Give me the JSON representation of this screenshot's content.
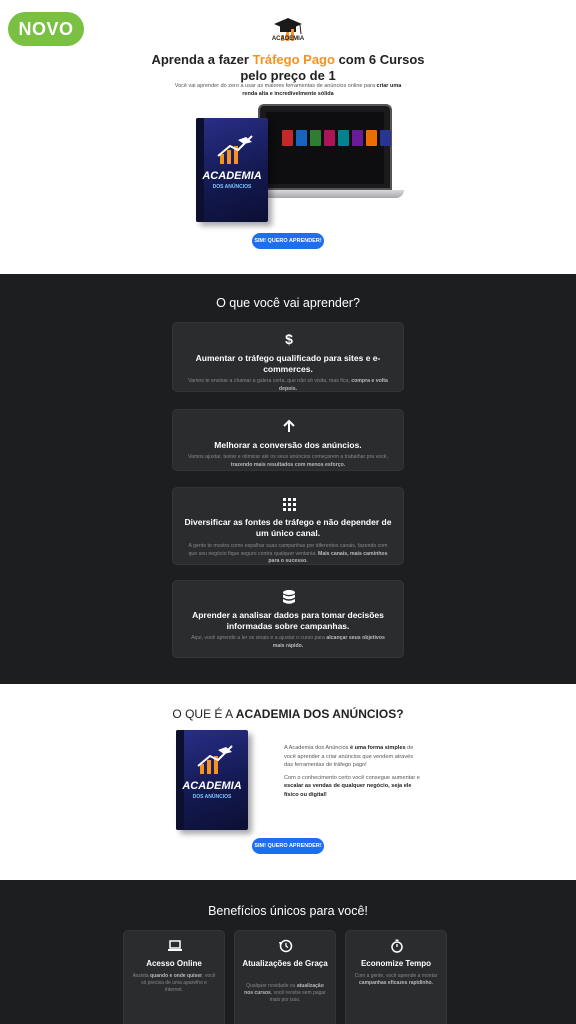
{
  "badge": "NOVO",
  "hero": {
    "logo_text": "ACADEMIA",
    "title_pre": "Aprenda a fazer ",
    "title_accent": "Tráfego Pago",
    "title_post": " com 6 Cursos pelo preço de 1",
    "sub_pre": "Você vai aprender do zero a usar as maiores ferramentas de anúncios online para ",
    "sub_bold": "criar uma renda alta e incredivelmente sólida",
    "box_brand": "ACADEMIA",
    "box_sub": "DOS ANÚNCIOS",
    "cta": "SIM! QUERO APRENDER!"
  },
  "learn": {
    "title": "O que você vai aprender?",
    "cards": [
      {
        "icon": "dollar-icon",
        "title": "Aumentar o tráfego qualificado para sites e e-commerces.",
        "desc_pre": "Vamos te ensinar a chamar a galera certa, que não só visita, mas fica, ",
        "desc_bold": "compra e volta depois.",
        "desc_post": ""
      },
      {
        "icon": "arrow-up-icon",
        "title": "Melhorar a conversão dos anúncios.",
        "desc_pre": "Vamos ajustar, testar e otimizar até os seus anúncios começarem a trabalhar pra você, ",
        "desc_bold": "trazendo mais resultados com menos esforço.",
        "desc_post": ""
      },
      {
        "icon": "grid-dots-icon",
        "title": "Diversificar as fontes de tráfego e não depender de um único canal.",
        "desc_pre": "A gente te mostra como espalhar suas campanhas por diferentes canais, fazendo com que seu negócio fique seguro contra qualquer ventania. ",
        "desc_bold": "Mais canais, mais caminhos para o sucesso.",
        "desc_post": ""
      },
      {
        "icon": "database-icon",
        "title": "Aprender a analisar dados para tomar decisões informadas sobre campanhas.",
        "desc_pre": "Aqui, você aprende a ler os sinais e a ajustar o curso para ",
        "desc_bold": "alcançar seus objetivos mais rápido.",
        "desc_post": ""
      }
    ]
  },
  "whatis": {
    "title_pre": "O QUE É A ",
    "title_bold": "ACADEMIA DOS ANÚNCIOS?",
    "p1_pre": "A Academia dos Anúncios ",
    "p1_bold": "é uma forma simples",
    "p1_post": " de você aprender a criar anúncios que vendem através das ferramentas de tráfego pago!",
    "p2_pre": "Com o conhecimento certo você consegue aumentar e ",
    "p2_bold": "escalar as vendas de qualquer negócio, seja ele físico ou digital!",
    "cta": "SIM! QUERO APRENDER!"
  },
  "benefits": {
    "title": "Benefícios únicos para você!",
    "cards": [
      {
        "icon": "laptop-icon",
        "title": "Acesso Online",
        "desc_pre": "Assista ",
        "desc_bold": "quando e onde quiser",
        "desc_post": ", você só precisa de uma aparelho e internet."
      },
      {
        "icon": "history-icon",
        "title": "Atualizações de Graça",
        "desc_pre": "Qualquer novidade ou ",
        "desc_bold": "atualização nos cursos",
        "desc_post": ", você recebe sem pagar mais por isso."
      },
      {
        "icon": "stopwatch-icon",
        "title": "Economize Tempo",
        "desc_pre": "Com a gente, você aprende a montar ",
        "desc_bold": "campanhas eficazes rapidinho.",
        "desc_post": ""
      }
    ]
  }
}
